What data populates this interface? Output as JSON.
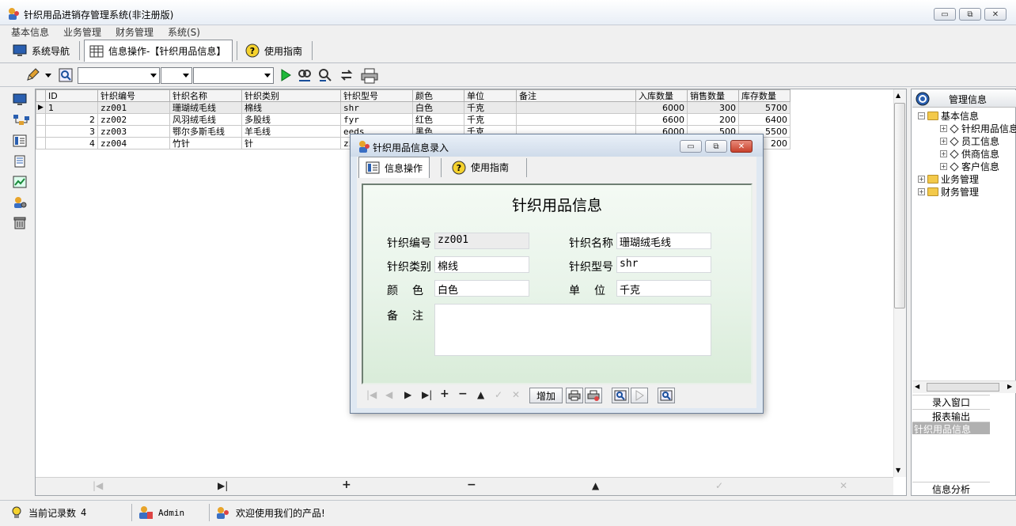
{
  "window": {
    "title": "针织用品进销存管理系统(非注册版)",
    "controls": {
      "minimize": "▭",
      "restore": "⧉",
      "close": "✕"
    }
  },
  "menu": [
    "基本信息",
    "业务管理",
    "财务管理",
    "系统(S)"
  ],
  "tabs": [
    {
      "label": "系统导航",
      "icon": "monitor-icon"
    },
    {
      "label": "信息操作-【针织用品信息】",
      "icon": "grid-icon",
      "active": true
    },
    {
      "label": "使用指南",
      "icon": "help-icon"
    }
  ],
  "toolbar": {
    "combo1": "",
    "combo2": "",
    "combo3": ""
  },
  "grid": {
    "columns": [
      "ID",
      "针织编号",
      "针织名称",
      "针织类别",
      "针织型号",
      "颜色",
      "单位",
      "备注",
      "入库数量",
      "销售数量",
      "库存数量"
    ],
    "rows": [
      [
        "1",
        "zz001",
        "珊瑚绒毛线",
        "棉线",
        "shr",
        "白色",
        "千克",
        "",
        "6000",
        "300",
        "5700"
      ],
      [
        "2",
        "zz002",
        "风羽绒毛线",
        "多股线",
        "fyr",
        "红色",
        "千克",
        "",
        "6600",
        "200",
        "6400"
      ],
      [
        "3",
        "zz003",
        "鄂尔多斯毛线",
        "羊毛线",
        "eeds",
        "黑色",
        "千克",
        "",
        "6000",
        "500",
        "5500"
      ],
      [
        "4",
        "zz004",
        "竹针",
        "针",
        "zz",
        "",
        "",
        "",
        "",
        "",
        "200"
      ]
    ]
  },
  "gridnav": {
    "first": "|◀",
    "last": "▶|",
    "add": "+",
    "delete": "−",
    "up": "▲",
    "post": "✓",
    "cancel": "✕"
  },
  "rightpanel": {
    "header": "管理信息",
    "tree": {
      "basic": "基本信息",
      "items": [
        "针织用品信息",
        "员工信息",
        "供商信息",
        "客户信息"
      ],
      "business": "业务管理",
      "finance": "财务管理"
    },
    "buttons": {
      "input": "录入窗口",
      "report": "报表输出",
      "current": "针织用品信息",
      "analysis": "信息分析"
    }
  },
  "status": {
    "records_label": "当前记录数",
    "records_count": "4",
    "user": "Admin",
    "welcome": "欢迎使用我们的产品!"
  },
  "dialog": {
    "title": "针织用品信息录入",
    "tabs": [
      "信息操作",
      "使用指南"
    ],
    "form_title": "针织用品信息",
    "fields": {
      "code_label": "针织编号",
      "code": "zz001",
      "name_label": "针织名称",
      "name": "珊瑚绒毛线",
      "category_label": "针织类别",
      "category": "棉线",
      "model_label": "针织型号",
      "model": "shr",
      "color_label": "颜　色",
      "color": "白色",
      "unit_label": "单　位",
      "unit": "千克",
      "remark_label": "备　注",
      "remark": ""
    },
    "nav": {
      "first": "|◀",
      "prior": "◀",
      "next": "▶",
      "last": "▶|",
      "add": "+",
      "delete": "−",
      "up": "▲",
      "post": "✓",
      "cancel": "✕",
      "add_button": "增加"
    }
  }
}
